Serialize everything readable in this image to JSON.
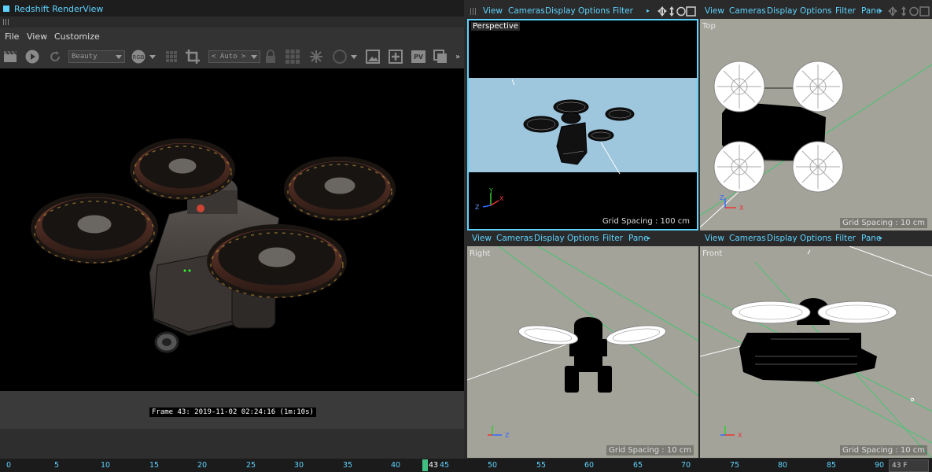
{
  "render_view": {
    "title": "Redshift RenderView",
    "menu": [
      "File",
      "View",
      "Customize"
    ],
    "aov_select": "Beauty",
    "rgb_label": "RGB",
    "zoom_select": "< Auto >",
    "stamp": "Frame  43:  2019-11-02  02:24:16  (1m:10s)"
  },
  "viewports": {
    "menu": [
      "View",
      "Cameras",
      "Display",
      "Options",
      "Filter",
      "Panel"
    ],
    "menu_short_last": "Pane",
    "perspective": {
      "name": "Perspective",
      "grid_spacing": "Grid Spacing : 100 cm"
    },
    "top": {
      "name": "Top",
      "grid_spacing": "Grid Spacing : 10 cm"
    },
    "right": {
      "name": "Right",
      "grid_spacing": "Grid Spacing : 10 cm"
    },
    "front": {
      "name": "Front",
      "grid_spacing": "Grid Spacing : 10 cm"
    },
    "axes": {
      "x": "X",
      "y": "Y",
      "z": "Z"
    }
  },
  "timeline": {
    "ticks": [
      "0",
      "5",
      "10",
      "15",
      "20",
      "25",
      "30",
      "35",
      "40",
      "43",
      "45",
      "50",
      "55",
      "60",
      "65",
      "70",
      "75",
      "80",
      "85",
      "90"
    ],
    "current_frame": "43",
    "frame_field": "43 F"
  },
  "colors": {
    "accent": "#5fd3ff",
    "viewport_bg": "#a3a39a",
    "sky": "#9ec6dc",
    "playhead": "#40c080"
  }
}
